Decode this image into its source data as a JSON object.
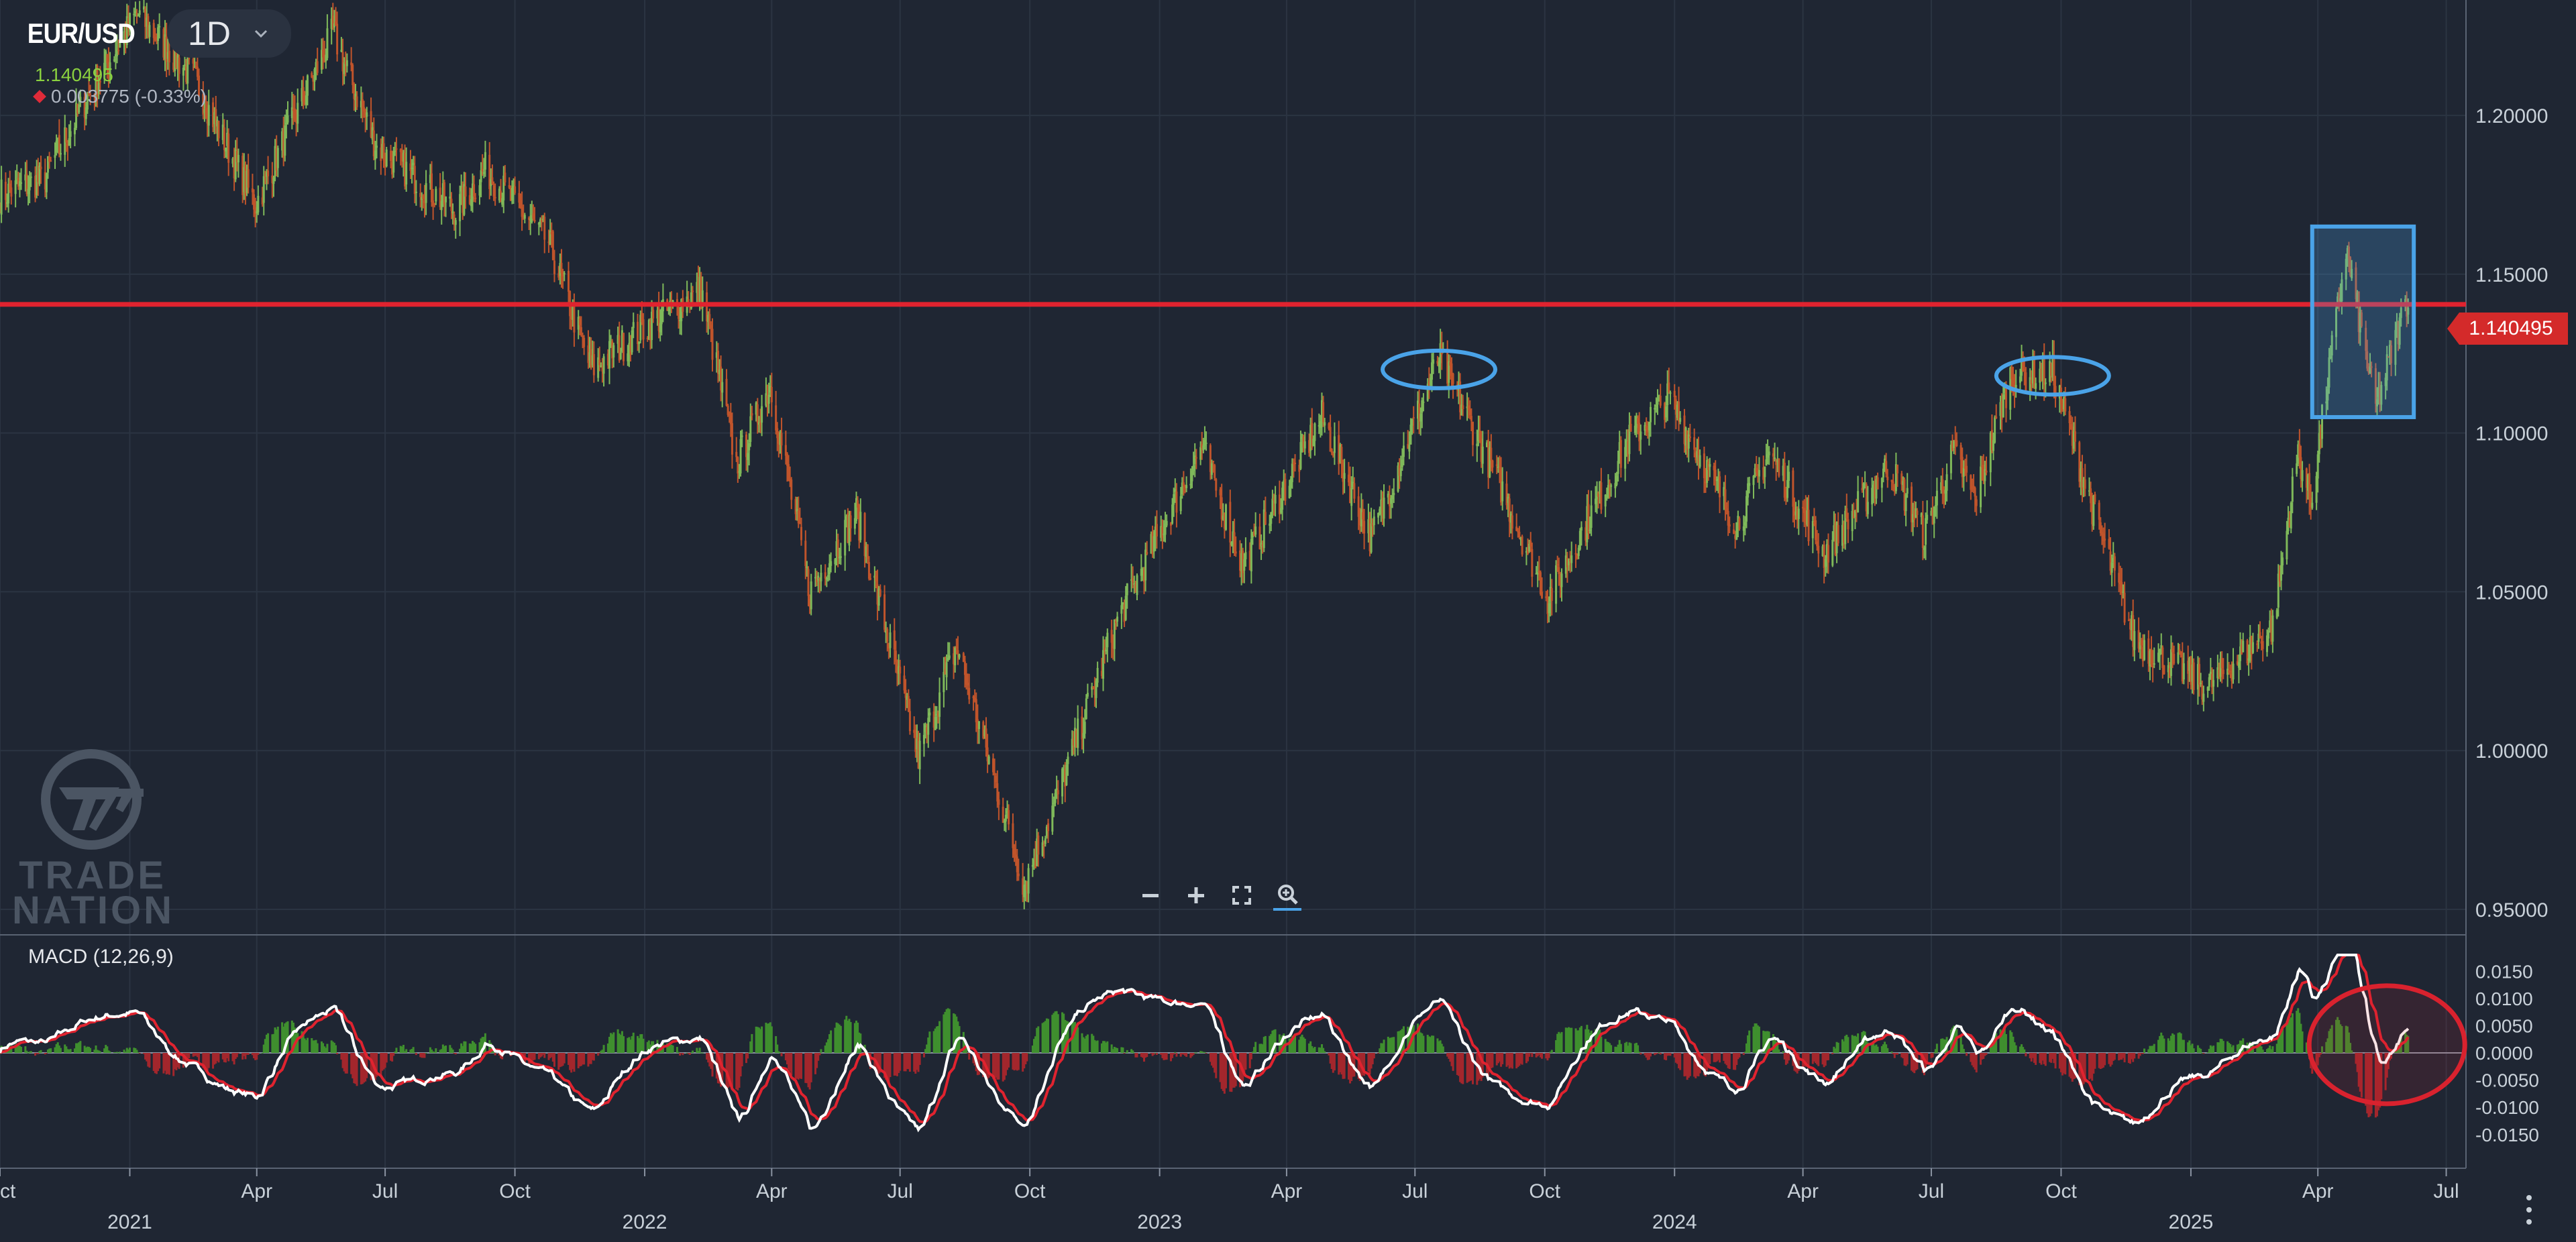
{
  "header": {
    "symbol": "EUR/USD",
    "interval": "1D",
    "last_price": "1.140495",
    "change": "0.003775 (-0.33%)",
    "change_color": "#e02b39",
    "price_color": "#8bd13f"
  },
  "indicator": {
    "label": "MACD (12,26,9)"
  },
  "current_price_badge": "1.140495",
  "watermark": {
    "line1": "TRADE",
    "line2": "NATION"
  },
  "zoom_controls": [
    "zoom-out-icon",
    "zoom-in-icon",
    "fullscreen-icon",
    "zoom-reset-icon"
  ],
  "colors": {
    "background": "#1f2633",
    "up_candle": "#7fb95a",
    "down_candle": "#c0542b",
    "resistance_line": "#e0232f",
    "highlight_blue": "#4aa3e8",
    "highlight_red": "#d9222e",
    "macd_line": "#ffffff",
    "signal_line": "#e0232f",
    "hist_up": "#3f8f2e",
    "hist_down": "#a3262c"
  },
  "chart_data": {
    "type": "candlestick",
    "symbol": "EUR/USD",
    "timeframe": "1D",
    "x_range": [
      "2020-10-01",
      "2025-07-15"
    ],
    "price_ylim": [
      0.95,
      1.23
    ],
    "price_ticks": [
      "1.20000",
      "1.15000",
      "1.10000",
      "1.05000",
      "1.00000",
      "0.95000"
    ],
    "price_tick_values": [
      1.2,
      1.15,
      1.1,
      1.05,
      1.0,
      0.95
    ],
    "x_tick_labels": [
      {
        "date": "2020-10-01",
        "label": "Oct"
      },
      {
        "date": "2021-01-01",
        "label": "2021"
      },
      {
        "date": "2021-04-01",
        "label": "Apr"
      },
      {
        "date": "2021-07-01",
        "label": "Jul"
      },
      {
        "date": "2021-10-01",
        "label": "Oct"
      },
      {
        "date": "2022-01-01",
        "label": "2022"
      },
      {
        "date": "2022-04-01",
        "label": "Apr"
      },
      {
        "date": "2022-07-01",
        "label": "Jul"
      },
      {
        "date": "2022-10-01",
        "label": "Oct"
      },
      {
        "date": "2023-01-01",
        "label": "2023"
      },
      {
        "date": "2023-04-01",
        "label": "Apr"
      },
      {
        "date": "2023-07-01",
        "label": "Jul"
      },
      {
        "date": "2023-10-01",
        "label": "Oct"
      },
      {
        "date": "2024-01-01",
        "label": "2024"
      },
      {
        "date": "2024-04-01",
        "label": "Apr"
      },
      {
        "date": "2024-07-01",
        "label": "Jul"
      },
      {
        "date": "2024-10-01",
        "label": "Oct"
      },
      {
        "date": "2025-01-01",
        "label": "2025"
      },
      {
        "date": "2025-04-01",
        "label": "Apr"
      },
      {
        "date": "2025-07-01",
        "label": "Jul"
      }
    ],
    "price_path": [
      [
        "2020-10-01",
        1.175
      ],
      [
        "2020-11-01",
        1.18
      ],
      [
        "2020-12-01",
        1.205
      ],
      [
        "2021-01-06",
        1.232
      ],
      [
        "2021-02-15",
        1.212
      ],
      [
        "2021-03-31",
        1.172
      ],
      [
        "2021-05-25",
        1.226
      ],
      [
        "2021-06-25",
        1.19
      ],
      [
        "2021-08-20",
        1.17
      ],
      [
        "2021-09-10",
        1.183
      ],
      [
        "2021-10-25",
        1.16
      ],
      [
        "2021-11-24",
        1.12
      ],
      [
        "2021-12-31",
        1.133
      ],
      [
        "2022-02-10",
        1.145
      ],
      [
        "2022-03-07",
        1.09
      ],
      [
        "2022-03-31",
        1.115
      ],
      [
        "2022-04-28",
        1.05
      ],
      [
        "2022-05-31",
        1.075
      ],
      [
        "2022-07-14",
        0.998
      ],
      [
        "2022-08-10",
        1.033
      ],
      [
        "2022-09-27",
        0.958
      ],
      [
        "2022-10-20",
        0.985
      ],
      [
        "2022-12-01",
        1.04
      ],
      [
        "2023-01-31",
        1.096
      ],
      [
        "2023-03-01",
        1.058
      ],
      [
        "2023-04-26",
        1.105
      ],
      [
        "2023-05-31",
        1.067
      ],
      [
        "2023-07-18",
        1.124
      ],
      [
        "2023-08-31",
        1.083
      ],
      [
        "2023-10-03",
        1.048
      ],
      [
        "2023-11-30",
        1.098
      ],
      [
        "2023-12-28",
        1.111
      ],
      [
        "2024-02-14",
        1.071
      ],
      [
        "2024-03-08",
        1.094
      ],
      [
        "2024-04-16",
        1.062
      ],
      [
        "2024-06-01",
        1.09
      ],
      [
        "2024-06-26",
        1.068
      ],
      [
        "2024-07-17",
        1.094
      ],
      [
        "2024-08-01",
        1.079
      ],
      [
        "2024-08-26",
        1.118
      ],
      [
        "2024-09-25",
        1.119
      ],
      [
        "2024-10-22",
        1.078
      ],
      [
        "2024-11-22",
        1.035
      ],
      [
        "2025-01-13",
        1.02
      ],
      [
        "2025-02-28",
        1.039
      ],
      [
        "2025-03-18",
        1.094
      ],
      [
        "2025-03-27",
        1.078
      ],
      [
        "2025-04-21",
        1.158
      ],
      [
        "2025-05-12",
        1.108
      ],
      [
        "2025-06-05",
        1.145
      ]
    ],
    "macd": {
      "label": "MACD (12,26,9)",
      "params": [
        12,
        26,
        9
      ],
      "ylim": [
        -0.017,
        0.018
      ],
      "ticks": [
        "0.0150",
        "0.0100",
        "0.0050",
        "0.0000",
        "-0.0050",
        "-0.0100",
        "-0.0150"
      ],
      "tick_values": [
        0.015,
        0.01,
        0.005,
        0.0,
        -0.005,
        -0.01,
        -0.015
      ]
    },
    "annotations": {
      "resistance": 1.1405,
      "ellipses": [
        {
          "date": "2023-07-18",
          "price": 1.12
        },
        {
          "date": "2024-09-25",
          "price": 1.118
        }
      ],
      "box": {
        "date_start": "2025-03-28",
        "date_end": "2025-06-08",
        "price_top": 1.165,
        "price_bottom": 1.105
      },
      "macd_circle": {
        "date": "2025-05-20",
        "value": 0.0015
      }
    }
  }
}
